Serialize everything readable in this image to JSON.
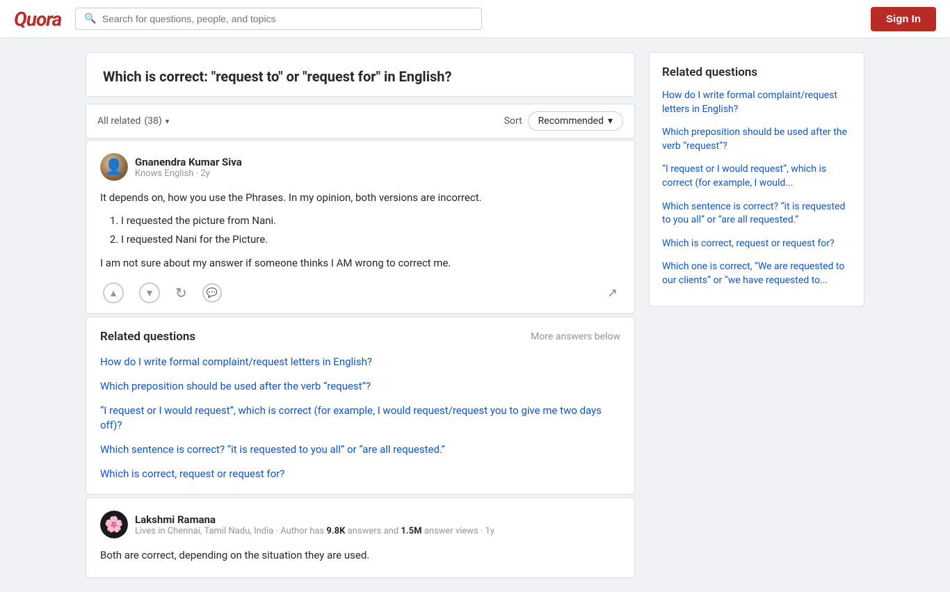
{
  "header": {
    "logo": "Quora",
    "search_placeholder": "Search for questions, people, and topics",
    "sign_in_label": "Sign In"
  },
  "question": {
    "title": "Which is correct: \"request to\" or \"request for\" in English?"
  },
  "filter_bar": {
    "all_related_label": "All related",
    "all_related_count": "(38)",
    "sort_label": "Sort",
    "recommended_label": "Recommended"
  },
  "answers": [
    {
      "id": "gnanendra",
      "author_name": "Gnanendra Kumar Siva",
      "author_meta": "Knows English · 2y",
      "intro": "It depends on, how you use the Phrases. In my opinion, both versions are incorrect.",
      "list_items": [
        "I requested the picture from Nani.",
        "I requested Nani for the Picture."
      ],
      "closing": "I am not sure about my answer if someone thinks I AM wrong to correct me."
    }
  ],
  "related_questions": {
    "section_title": "Related questions",
    "more_answers_label": "More answers below",
    "items": [
      "How do I write formal complaint/request letters in English?",
      "Which preposition should be used after the verb “request”?",
      "“I request or I would request”, which is correct (for example, I would request/request you to give me two days off)?",
      "Which sentence is correct? “it is requested to you all” or “are all requested.”",
      "Which is correct, request or request for?"
    ]
  },
  "second_answer": {
    "author_name": "Lakshmi Ramana",
    "author_meta_prefix": "Lives in Chennai, Tamil Nadu, India · Author has",
    "answers_count": "9.8K",
    "answers_label": "answers and",
    "views_count": "1.5M",
    "views_label": "answer views · 1y",
    "preview_text": "Both are correct, depending on the situation they are used."
  },
  "sidebar": {
    "title": "Related questions",
    "links": [
      "How do I write formal complaint/request letters in English?",
      "Which preposition should be used after the verb “request”?",
      "“I request or I would request”, which is correct (for example, I would...",
      "Which sentence is correct? “it is requested to you all” or “are all requested.”",
      "Which is correct, request or request for?",
      "Which one is correct, “We are requested to our clients” or “we have requested to..."
    ]
  },
  "icons": {
    "upvote": "▲",
    "downvote": "▼",
    "share_rotate": "↻",
    "comment": "○",
    "share_arrow": "↗",
    "chevron_down": "▾",
    "search": "🔍"
  }
}
